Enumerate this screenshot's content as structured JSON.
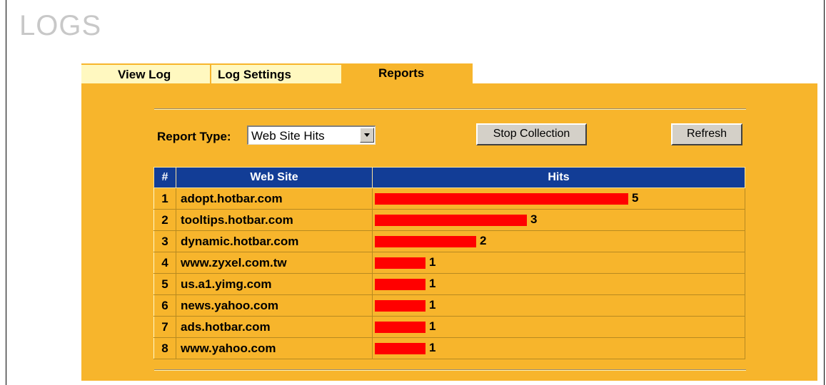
{
  "page": {
    "title": "LOGS"
  },
  "tabs": [
    {
      "label": "View Log",
      "active": false
    },
    {
      "label": "Log Settings",
      "active": false
    },
    {
      "label": "Reports",
      "active": true
    }
  ],
  "controls": {
    "report_type_label": "Report Type:",
    "report_type_value": "Web Site Hits",
    "stop_button": "Stop Collection",
    "refresh_button": "Refresh"
  },
  "table": {
    "headers": [
      "#",
      "Web Site",
      "Hits"
    ],
    "max_hits": 5,
    "rows": [
      {
        "num": "1",
        "site": "adopt.hotbar.com",
        "hits": 5
      },
      {
        "num": "2",
        "site": "tooltips.hotbar.com",
        "hits": 3
      },
      {
        "num": "3",
        "site": "dynamic.hotbar.com",
        "hits": 2
      },
      {
        "num": "4",
        "site": "www.zyxel.com.tw",
        "hits": 1
      },
      {
        "num": "5",
        "site": "us.a1.yimg.com",
        "hits": 1
      },
      {
        "num": "6",
        "site": "news.yahoo.com",
        "hits": 1
      },
      {
        "num": "7",
        "site": "ads.hotbar.com",
        "hits": 1
      },
      {
        "num": "8",
        "site": "www.yahoo.com",
        "hits": 1
      }
    ]
  },
  "colors": {
    "panel": "#f7b52c",
    "inactive_tab": "#FFF8C0",
    "header": "#123d96",
    "bar": "#ff0000",
    "title": "#c8c8c8"
  }
}
